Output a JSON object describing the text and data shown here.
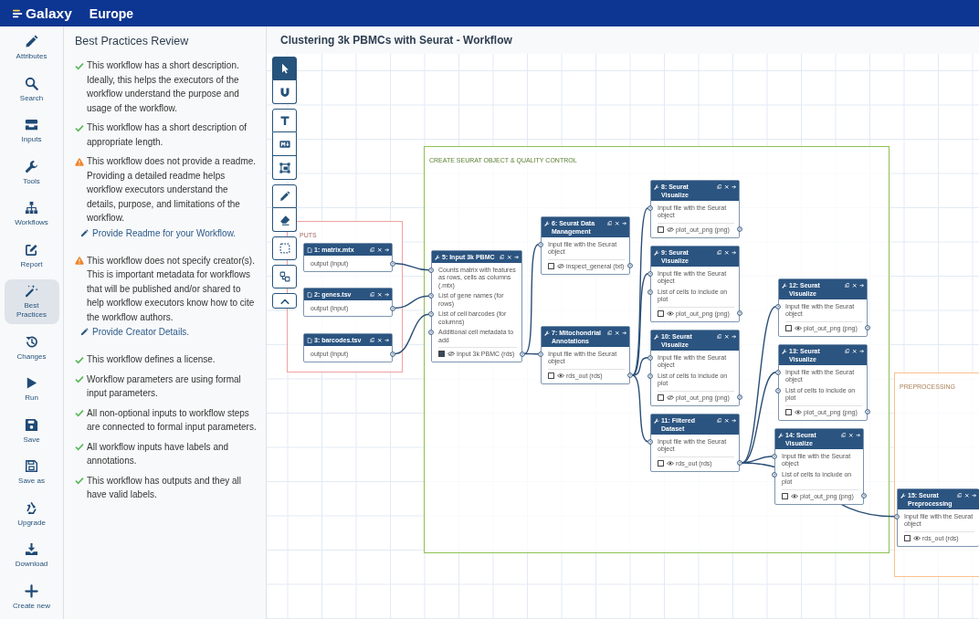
{
  "masthead": {
    "brand": "Galaxy",
    "site": "Europe"
  },
  "activity_bar": [
    {
      "kind": "attributes",
      "label": "Attributes",
      "selected": false
    },
    {
      "kind": "search",
      "label": "Search",
      "selected": false
    },
    {
      "kind": "inputs",
      "label": "Inputs",
      "selected": false
    },
    {
      "kind": "tools",
      "label": "Tools",
      "selected": false
    },
    {
      "kind": "workflows",
      "label": "Workflows",
      "selected": false
    },
    {
      "kind": "report",
      "label": "Report",
      "selected": false
    },
    {
      "kind": "best_practices",
      "label": "Best Practices",
      "selected": true
    },
    {
      "kind": "changes",
      "label": "Changes",
      "selected": false
    },
    {
      "kind": "run",
      "label": "Run",
      "selected": false
    },
    {
      "kind": "save",
      "label": "Save",
      "selected": false
    },
    {
      "kind": "save_as",
      "label": "Save as",
      "selected": false
    },
    {
      "kind": "upgrade",
      "label": "Upgrade",
      "selected": false
    },
    {
      "kind": "download",
      "label": "Download",
      "selected": false
    },
    {
      "kind": "create_new",
      "label": "Create new",
      "selected": false
    }
  ],
  "panel": {
    "title": "Best Practices Review",
    "items": [
      {
        "kind": "ok",
        "text": "This workflow has a short description. Ideally, this helps the executors of the workflow understand the purpose and usage of the workflow."
      },
      {
        "kind": "ok",
        "text": "This workflow has a short description of appropriate length."
      },
      {
        "kind": "warning",
        "text": "This workflow does not provide a readme. Providing a detailed readme helps workflow executors understand the details, purpose, and limitations of the workflow.",
        "action": "Provide Readme for your Workflow."
      },
      {
        "kind": "warning",
        "text": "This workflow does not specify creator(s). This is important metadata for workflows that will be published and/or shared to help workflow executors know how to cite the workflow authors.",
        "action": "Provide Creator Details."
      },
      {
        "kind": "ok",
        "text": "This workflow defines a license."
      },
      {
        "kind": "ok",
        "text": "Workflow parameters are using formal input parameters."
      },
      {
        "kind": "ok",
        "text": "All non-optional inputs to workflow steps are connected to formal input parameters."
      },
      {
        "kind": "ok",
        "text": "All workflow inputs have labels and annotations."
      },
      {
        "kind": "ok",
        "text": "This workflow has outputs and they all have valid labels."
      }
    ]
  },
  "workflow": {
    "title": "Clustering 3k PBMCs with Seurat - Workflow",
    "toolbar": [
      [
        {
          "kind": "pointer",
          "selected": true
        },
        {
          "kind": "magnet",
          "selected": false
        }
      ],
      [
        {
          "kind": "text",
          "selected": false
        },
        {
          "kind": "markdown",
          "selected": false
        },
        {
          "kind": "frame",
          "selected": false
        }
      ],
      [
        {
          "kind": "pencil",
          "selected": false
        },
        {
          "kind": "eraser",
          "selected": false
        }
      ],
      [
        {
          "kind": "box_select",
          "selected": false
        }
      ],
      [
        {
          "kind": "auto_layout",
          "selected": false
        }
      ],
      [
        {
          "kind": "collapse",
          "selected": false
        }
      ]
    ],
    "frames": [
      {
        "label": "PUTS",
        "color": "#f0a0a0"
      },
      {
        "label": "CREATE SEURAT OBJECT & QUALITY CONTROL",
        "color": "#8cc152"
      },
      {
        "label": "PREPROCESSING",
        "color": "#fbc08a"
      }
    ],
    "nodes": [
      {
        "kind": "input",
        "title": "1: matrix.mtx",
        "outputs": [
          {
            "label": "output (input)"
          }
        ]
      },
      {
        "kind": "input",
        "title": "2: genes.tsv",
        "outputs": [
          {
            "label": "output (input)"
          }
        ]
      },
      {
        "kind": "input",
        "title": "3: barcodes.tsv",
        "outputs": [
          {
            "label": "output (input)"
          }
        ]
      },
      {
        "kind": "tool",
        "title": "5: Input 3k PBMC",
        "inputs": [
          "Counts matrix with features as rows, cells as columns (.mtx)",
          "List of gene names (for rows)",
          "List of cell barcodes (for columns)",
          "Additional cell metadata to add"
        ],
        "outputs": [
          {
            "label": "Input 3k PBMC (rds)",
            "checked": true,
            "visible": false
          }
        ]
      },
      {
        "kind": "tool",
        "title": "6: Seurat Data Management",
        "inputs": [
          "Input file with the Seurat object"
        ],
        "outputs": [
          {
            "label": "inspect_general (txt)",
            "checked": false,
            "visible": false
          }
        ]
      },
      {
        "kind": "tool",
        "title": "7: Mitochondrial Annotations",
        "inputs": [
          "Input file with the Seurat object"
        ],
        "outputs": [
          {
            "label": "rds_out (rds)",
            "checked": false,
            "visible": true
          }
        ]
      },
      {
        "kind": "tool",
        "title": "8: Seurat Visualize",
        "inputs": [
          "Input file with the Seurat object"
        ],
        "outputs": [
          {
            "label": "plot_out_png (png)",
            "checked": false,
            "visible": false
          }
        ]
      },
      {
        "kind": "tool",
        "title": "9: Seurat Visualize",
        "inputs": [
          "Input file with the Seurat object",
          "List of cells to include on plot"
        ],
        "outputs": [
          {
            "label": "plot_out_png (png)",
            "checked": false,
            "visible": true
          }
        ]
      },
      {
        "kind": "tool",
        "title": "10: Seurat Visualize",
        "inputs": [
          "Input file with the Seurat object",
          "List of cells to include on plot"
        ],
        "outputs": [
          {
            "label": "plot_out_png (png)",
            "checked": false,
            "visible": false
          }
        ]
      },
      {
        "kind": "tool",
        "title": "11: Filtered Dataset",
        "inputs": [
          "Input file with the Seurat object"
        ],
        "outputs": [
          {
            "label": "rds_out (rds)",
            "checked": false,
            "visible": true
          }
        ]
      },
      {
        "kind": "tool",
        "title": "12: Seurat Visualize",
        "inputs": [
          "Input file with the Seurat object"
        ],
        "outputs": [
          {
            "label": "plot_out_png (png)",
            "checked": false,
            "visible": true
          }
        ]
      },
      {
        "kind": "tool",
        "title": "13: Seurat Visualize",
        "inputs": [
          "Input file with the Seurat object",
          "List of cells to include on plot"
        ],
        "outputs": [
          {
            "label": "plot_out_png (png)",
            "checked": false,
            "visible": true
          }
        ]
      },
      {
        "kind": "tool",
        "title": "14: Seurat Visualize",
        "inputs": [
          "Input file with the Seurat object",
          "List of cells to include on plot"
        ],
        "outputs": [
          {
            "label": "plot_out_png (png)",
            "checked": false,
            "visible": true
          }
        ]
      },
      {
        "kind": "tool",
        "title": "15: Seurat Preprocessing",
        "inputs": [
          "Input file with the Seurat object"
        ],
        "outputs": [
          {
            "label": "rds_out (rds)",
            "checked": false,
            "visible": true
          }
        ]
      }
    ]
  }
}
